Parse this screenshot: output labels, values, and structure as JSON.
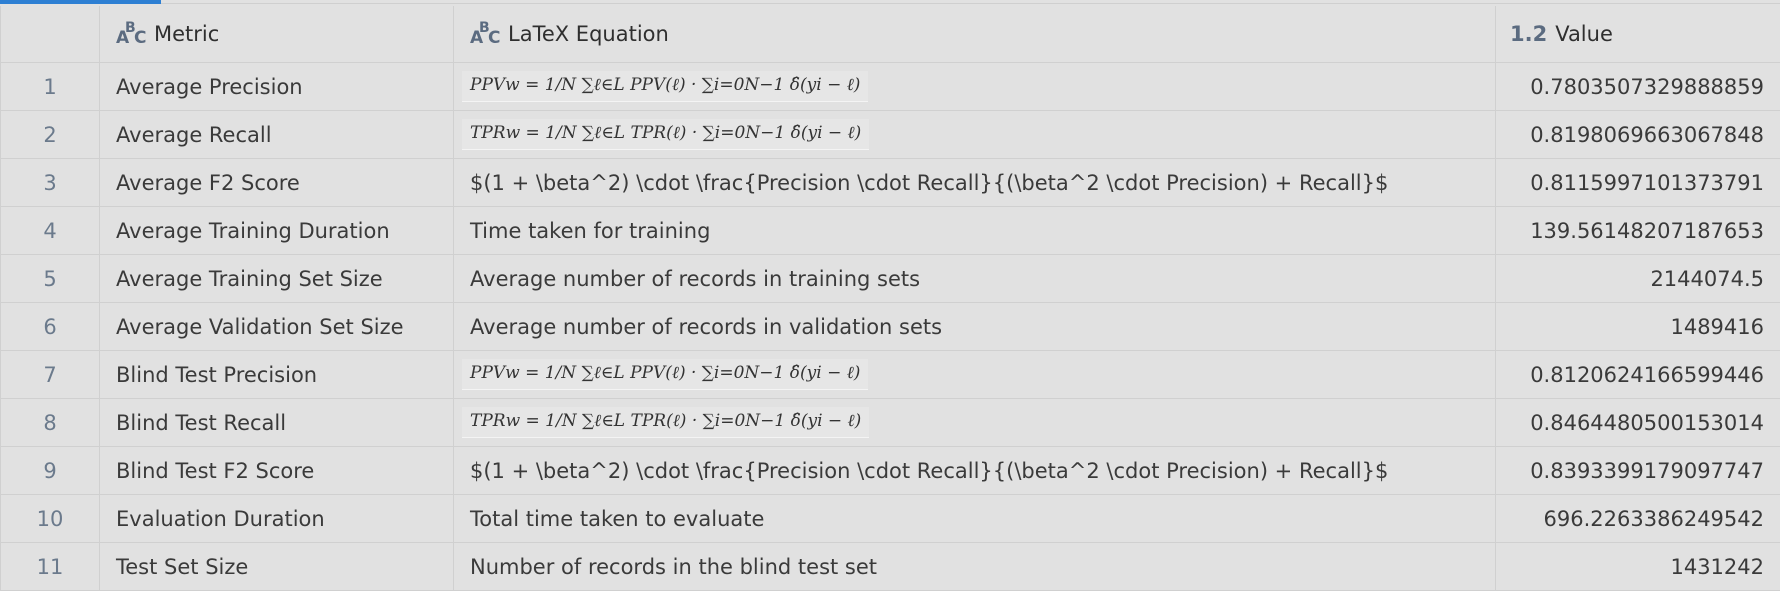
{
  "columns": {
    "metric": "Metric",
    "equation": "LaTeX Equation",
    "value": "Value",
    "value_type": "1.2"
  },
  "rows": [
    {
      "index": "1",
      "metric": "Average Precision",
      "equation": "PPVw = 1/N ∑ℓ∈L PPV(ℓ) · ∑i=0N−1 δ̂(yi − ℓ)",
      "equation_is_formula": true,
      "value": "0.7803507329888859"
    },
    {
      "index": "2",
      "metric": "Average Recall",
      "equation": "TPRw = 1/N ∑ℓ∈L TPR(ℓ) · ∑i=0N−1 δ̂(yi − ℓ)",
      "equation_is_formula": true,
      "value": "0.8198069663067848"
    },
    {
      "index": "3",
      "metric": "Average F2 Score",
      "equation": "$(1 + \\beta^2) \\cdot \\frac{Precision \\cdot Recall}{(\\beta^2 \\cdot Precision) + Recall}$",
      "equation_is_formula": false,
      "value": "0.8115997101373791"
    },
    {
      "index": "4",
      "metric": "Average Training Duration",
      "equation": "Time taken for training",
      "equation_is_formula": false,
      "value": "139.56148207187653"
    },
    {
      "index": "5",
      "metric": "Average Training Set Size",
      "equation": "Average number of records in training sets",
      "equation_is_formula": false,
      "value": "2144074.5"
    },
    {
      "index": "6",
      "metric": "Average Validation Set Size",
      "equation": "Average number of records in validation sets",
      "equation_is_formula": false,
      "value": "1489416"
    },
    {
      "index": "7",
      "metric": "Blind Test Precision",
      "equation": "PPVw = 1/N ∑ℓ∈L PPV(ℓ) · ∑i=0N−1 δ̂(yi − ℓ)",
      "equation_is_formula": true,
      "value": "0.8120624166599446"
    },
    {
      "index": "8",
      "metric": "Blind Test Recall",
      "equation": "TPRw = 1/N ∑ℓ∈L TPR(ℓ) · ∑i=0N−1 δ̂(yi − ℓ)",
      "equation_is_formula": true,
      "value": "0.8464480500153014"
    },
    {
      "index": "9",
      "metric": "Blind Test F2 Score",
      "equation": "$(1 + \\beta^2) \\cdot \\frac{Precision \\cdot Recall}{(\\beta^2 \\cdot Precision) + Recall}$",
      "equation_is_formula": false,
      "value": "0.8393399179097747"
    },
    {
      "index": "10",
      "metric": "Evaluation Duration",
      "equation": "Total time taken to evaluate",
      "equation_is_formula": false,
      "value": "696.2263386249542"
    },
    {
      "index": "11",
      "metric": "Test Set Size",
      "equation": "Number of records in the blind test set",
      "equation_is_formula": false,
      "value": "1431242"
    }
  ],
  "colors": {
    "accent": "#2d7fd3",
    "background": "#e1e1e1",
    "icon": "#5b6b80",
    "index_text": "#6b7a8c"
  }
}
